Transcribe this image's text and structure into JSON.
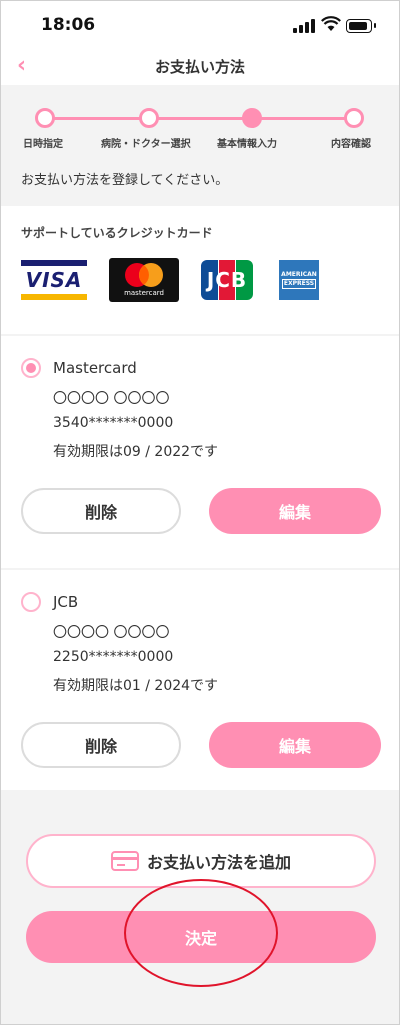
{
  "status_bar": {
    "time": "18:06"
  },
  "nav": {
    "title": "お支払い方法",
    "back_glyph": "‹"
  },
  "stepper": {
    "steps": [
      {
        "label": "日時指定",
        "state": "done"
      },
      {
        "label": "病院・ドクター選択",
        "state": "done"
      },
      {
        "label": "基本情報入力",
        "state": "current"
      },
      {
        "label": "内容確認",
        "state": "todo"
      }
    ],
    "instruction": "お支払い方法を登録してください。"
  },
  "supported": {
    "title": "サポートしているクレジットカード",
    "logos": [
      {
        "name": "visa",
        "text": "VISA"
      },
      {
        "name": "mastercard",
        "text": "mastercard"
      },
      {
        "name": "jcb",
        "text": "JCB"
      },
      {
        "name": "amex",
        "text_line1": "AMERICAN",
        "text_line2": "EXPRESS"
      }
    ]
  },
  "cards": [
    {
      "brand": "Mastercard",
      "holder": "〇〇〇〇 〇〇〇〇",
      "number": "3540*******0000",
      "expiry": "有効期限は09 / 2022です",
      "selected": true,
      "delete_label": "削除",
      "edit_label": "編集"
    },
    {
      "brand": "JCB",
      "holder": "〇〇〇〇 〇〇〇〇",
      "number": "2250*******0000",
      "expiry": "有効期限は01 / 2024です",
      "selected": false,
      "delete_label": "削除",
      "edit_label": "編集"
    }
  ],
  "actions": {
    "add_label": "お支払い方法を追加",
    "confirm_label": "決定"
  },
  "colors": {
    "accent": "#ff8fb3",
    "annotation": "#e0142b"
  }
}
